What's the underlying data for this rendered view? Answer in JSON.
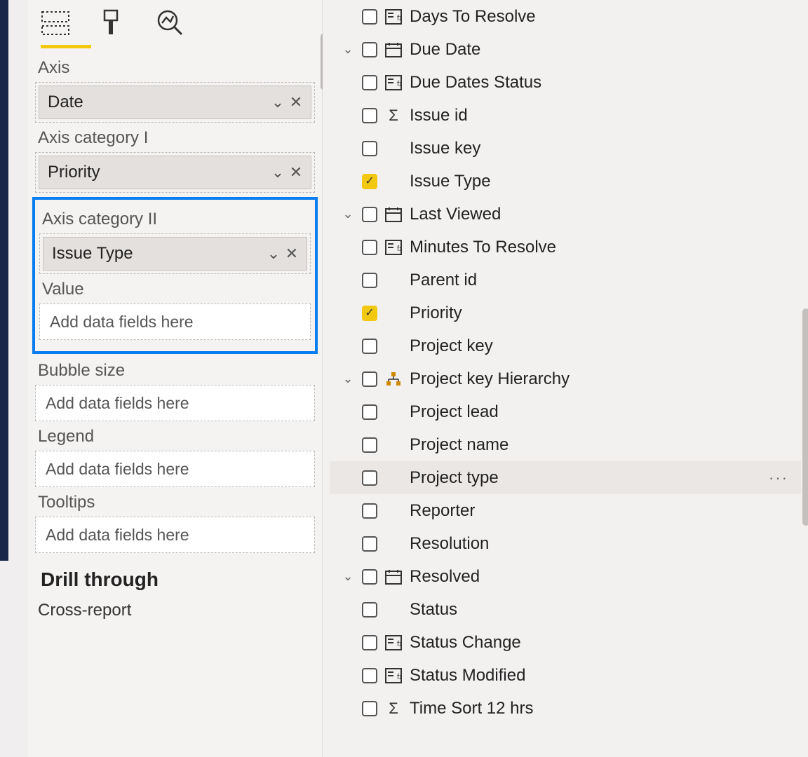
{
  "viz": {
    "wells": {
      "axis": {
        "label": "Axis",
        "pill": "Date"
      },
      "axis_cat1": {
        "label": "Axis category I",
        "pill": "Priority"
      },
      "axis_cat2": {
        "label": "Axis category II",
        "pill": "Issue Type"
      },
      "value": {
        "label": "Value",
        "placeholder": "Add data fields here"
      },
      "bubble": {
        "label": "Bubble size",
        "placeholder": "Add data fields here"
      },
      "legend": {
        "label": "Legend",
        "placeholder": "Add data fields here"
      },
      "tooltips": {
        "label": "Tooltips",
        "placeholder": "Add data fields here"
      }
    },
    "drill_header": "Drill through",
    "cross_report": "Cross-report"
  },
  "fields": {
    "items": [
      {
        "label": "Days To Resolve",
        "icon": "calc",
        "expand": "",
        "checked": false
      },
      {
        "label": "Due Date",
        "icon": "calendar",
        "expand": "v",
        "checked": false
      },
      {
        "label": "Due Dates Status",
        "icon": "calc",
        "expand": "",
        "checked": false
      },
      {
        "label": "Issue id",
        "icon": "sigma",
        "expand": "",
        "checked": false
      },
      {
        "label": "Issue key",
        "icon": "",
        "expand": "",
        "checked": false
      },
      {
        "label": "Issue Type",
        "icon": "",
        "expand": "",
        "checked": true
      },
      {
        "label": "Last Viewed",
        "icon": "calendar",
        "expand": "v",
        "checked": false
      },
      {
        "label": "Minutes To Resolve",
        "icon": "calc",
        "expand": "",
        "checked": false
      },
      {
        "label": "Parent id",
        "icon": "",
        "expand": "",
        "checked": false
      },
      {
        "label": "Priority",
        "icon": "",
        "expand": "",
        "checked": true
      },
      {
        "label": "Project key",
        "icon": "",
        "expand": "",
        "checked": false
      },
      {
        "label": "Project key Hierarchy",
        "icon": "hierarchy",
        "expand": "v",
        "checked": false
      },
      {
        "label": "Project lead",
        "icon": "",
        "expand": "",
        "checked": false
      },
      {
        "label": "Project name",
        "icon": "",
        "expand": "",
        "checked": false
      },
      {
        "label": "Project type",
        "icon": "",
        "expand": "",
        "checked": false,
        "hover": true
      },
      {
        "label": "Reporter",
        "icon": "",
        "expand": "",
        "checked": false
      },
      {
        "label": "Resolution",
        "icon": "",
        "expand": "",
        "checked": false
      },
      {
        "label": "Resolved",
        "icon": "calendar",
        "expand": "v",
        "checked": false
      },
      {
        "label": "Status",
        "icon": "",
        "expand": "",
        "checked": false
      },
      {
        "label": "Status Change",
        "icon": "calc",
        "expand": "",
        "checked": false
      },
      {
        "label": "Status Modified",
        "icon": "calc",
        "expand": "",
        "checked": false
      },
      {
        "label": "Time Sort 12 hrs",
        "icon": "sigma",
        "expand": "",
        "checked": false
      }
    ]
  }
}
